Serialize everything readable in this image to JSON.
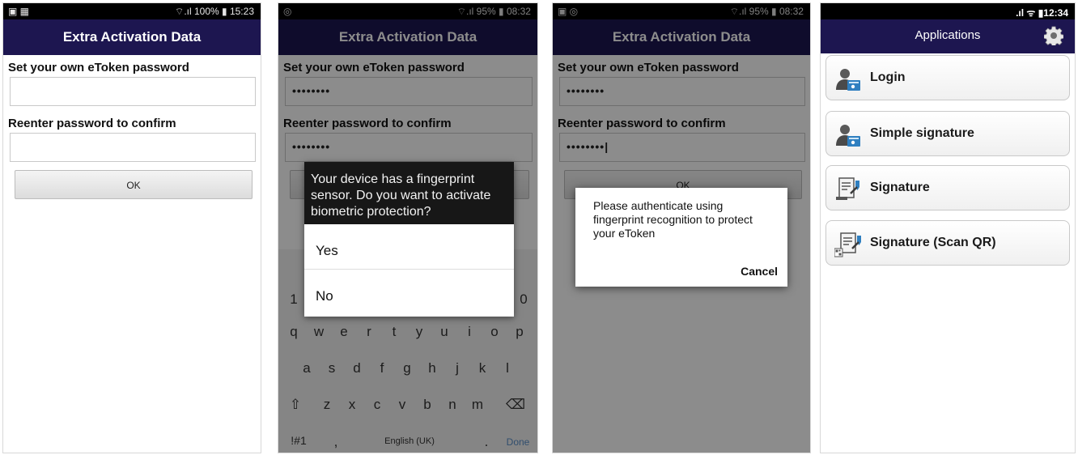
{
  "panel1": {
    "status_left": "▣ ▦",
    "status_right": "⌔.ıl 100% ▮ 15:23",
    "title": "Extra Activation Data",
    "label_password": "Set your own eToken password",
    "password_value": "",
    "label_confirm": "Reenter password to confirm",
    "confirm_value": "",
    "ok_label": "OK"
  },
  "panel2": {
    "status_left": "◎",
    "status_right": "⌔.ıl 95% ▮ 08:32",
    "title": "Extra Activation Data",
    "label_password": "Set your own eToken password",
    "password_value": "••••••••",
    "label_confirm": "Reenter password to confirm",
    "confirm_value": "••••••••",
    "dialog_text": "Your device has a fingerprint sensor. Do you want to activate biometric protection?",
    "option_yes": "Yes",
    "option_no": "No",
    "keyboard": {
      "row_num_left": "1",
      "row_num_right": "0",
      "row1": [
        "q",
        "w",
        "e",
        "r",
        "t",
        "y",
        "u",
        "i",
        "o",
        "p"
      ],
      "row2": [
        "a",
        "s",
        "d",
        "f",
        "g",
        "h",
        "j",
        "k",
        "l"
      ],
      "row3": [
        "⇧",
        "z",
        "x",
        "c",
        "v",
        "b",
        "n",
        "m",
        "⌫"
      ],
      "sym": "!#1",
      "comma": ",",
      "space": "English (UK)",
      "period": ".",
      "done": "Done"
    }
  },
  "panel3": {
    "status_left": "▣ ◎",
    "status_right": "⌔.ıl 95% ▮ 08:32",
    "title": "Extra Activation Data",
    "label_password": "Set your own eToken password",
    "password_value": "••••••••",
    "label_confirm": "Reenter password to confirm",
    "confirm_value": "••••••••|",
    "ok_label": "OK",
    "dialog_text": "Please authenticate using fingerprint recognition to protect your eToken",
    "cancel_label": "Cancel"
  },
  "panel4": {
    "status_right": ".ıl ᯤ ▮12:34",
    "title": "Applications",
    "items": [
      {
        "label": "Login",
        "icon": "user-card-icon"
      },
      {
        "label": "Simple signature",
        "icon": "user-card-icon"
      },
      {
        "label": "Signature",
        "icon": "document-sign-icon"
      },
      {
        "label": "Signature (Scan QR)",
        "icon": "document-qr-icon"
      }
    ]
  },
  "colors": {
    "appbar": "#1d1650",
    "status": "#000000"
  }
}
